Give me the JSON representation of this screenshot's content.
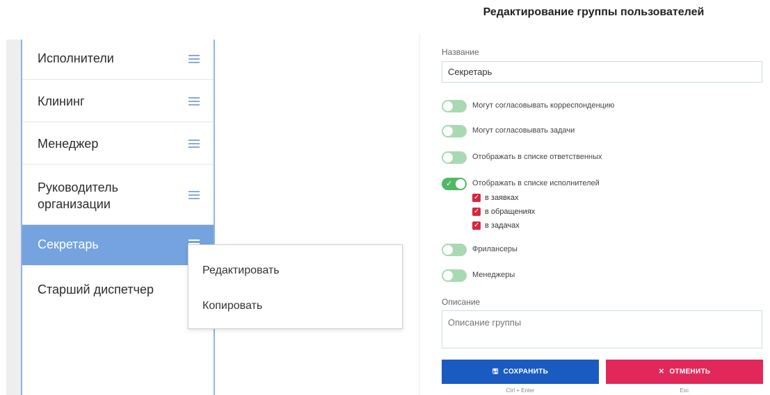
{
  "group_list": {
    "items": [
      {
        "label": "Исполнители"
      },
      {
        "label": "Клининг"
      },
      {
        "label": "Менеджер"
      },
      {
        "label": "Руководитель организации"
      },
      {
        "label": "Секретарь",
        "active": true
      },
      {
        "label": "Старший диспетчер"
      }
    ]
  },
  "context_menu": {
    "edit": "Редактировать",
    "copy": "Копировать"
  },
  "edit_panel": {
    "title": "Редактирование группы пользователей",
    "name_label": "Название",
    "name_value": "Секретарь",
    "toggles": [
      {
        "label": "Могут согласовывать корреспонденцию",
        "on": false
      },
      {
        "label": "Могут согласовывать задачи",
        "on": false
      },
      {
        "label": "Отображать в списке ответственных",
        "on": false
      },
      {
        "label": "Отображать в списке исполнителей",
        "on": true
      },
      {
        "label": "Фрилансеры",
        "on": false
      },
      {
        "label": "Менеджеры",
        "on": false
      }
    ],
    "executor_checks": [
      {
        "label": "в заявках",
        "checked": true
      },
      {
        "label": "в обращениях",
        "checked": true
      },
      {
        "label": "в задачах",
        "checked": true
      }
    ],
    "description_label": "Описание",
    "description_placeholder": "Описание группы",
    "save_label": "СОХРАНИТЬ",
    "save_hint": "Ctrl + Enter",
    "cancel_label": "ОТМЕНИТЬ",
    "cancel_hint": "Esc"
  },
  "colors": {
    "accent_blue": "#1a5bc2",
    "active_item": "#74a3e0",
    "cancel_red": "#e2285a",
    "toggle_on": "#4fb865",
    "toggle_off": "#a8d9b3",
    "checkbox_red": "#d9263e"
  }
}
